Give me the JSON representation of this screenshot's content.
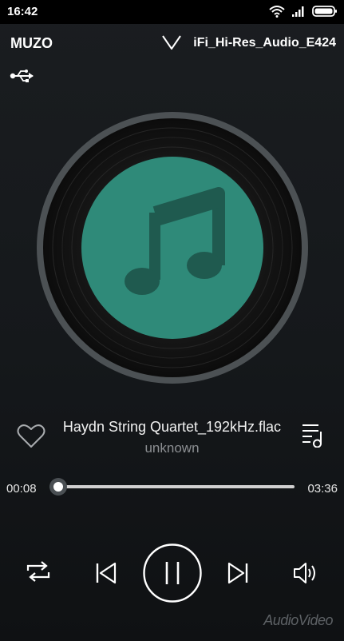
{
  "status_bar": {
    "time": "16:42"
  },
  "header": {
    "app_name": "MUZO",
    "device_name": "iFi_Hi-Res_Audio_E424"
  },
  "now_playing": {
    "title": "Haydn String Quartet_192kHz.flac",
    "artist": "unknown",
    "artwork_icon": "music-note-icon",
    "accent_color": "#2f8a79"
  },
  "progress": {
    "elapsed": "00:08",
    "duration": "03:36",
    "fraction": 0.037
  },
  "controls": {
    "repeat_icon": "repeat-icon",
    "prev_icon": "skip-previous-icon",
    "pause_icon": "pause-icon",
    "next_icon": "skip-next-icon",
    "volume_icon": "volume-icon"
  },
  "watermark": "AudioVideo"
}
